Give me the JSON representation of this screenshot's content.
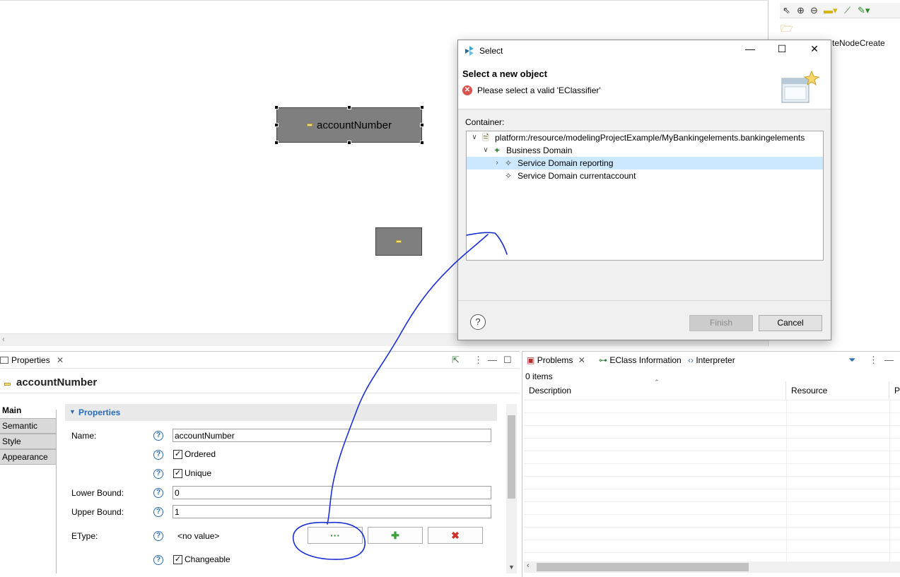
{
  "canvas": {
    "node_main_label": "accountNumber"
  },
  "palette": {
    "partial_label": "teNodeCreate",
    "tools": [
      "select-icon",
      "zoom-in-icon",
      "zoom-out-icon",
      "note-icon",
      "connection-icon",
      "pin-icon"
    ]
  },
  "dialog": {
    "title": "Select",
    "heading": "Select a new object",
    "error_message": "Please select a valid 'EClassifier'",
    "container_label": "Container:",
    "tree": [
      {
        "label": "platform:/resource/modelingProjectExample/MyBankingelements.bankingelements",
        "expanded": true,
        "level": 0
      },
      {
        "label": "Business Domain",
        "expanded": true,
        "level": 1
      },
      {
        "label": "Service Domain reporting",
        "expanded": false,
        "level": 2,
        "selected": true
      },
      {
        "label": "Service Domain currentaccount",
        "expanded": false,
        "level": 2
      }
    ],
    "help_symbol": "?",
    "finish_label": "Finish",
    "cancel_label": "Cancel",
    "minimize_symbol": "—",
    "maximize_symbol": "☐",
    "close_symbol": "✕"
  },
  "properties": {
    "tab_label": "Properties",
    "title": "accountNumber",
    "side_tabs": [
      "Main",
      "Semantic",
      "Style",
      "Appearance"
    ],
    "active_side_tab": "Main",
    "section_title": "Properties",
    "name_label": "Name:",
    "name_value": "accountNumber",
    "ordered_label": "Ordered",
    "ordered_checked": true,
    "unique_label": "Unique",
    "unique_checked": true,
    "lower_bound_label": "Lower Bound:",
    "lower_bound_value": "0",
    "upper_bound_label": "Upper Bound:",
    "upper_bound_value": "1",
    "etype_label": "EType:",
    "etype_value": "<no value>",
    "browse_button": "···",
    "add_button": "✚",
    "remove_button": "✖",
    "changeable_label": "Changeable",
    "changeable_checked": true,
    "help_symbol": "?"
  },
  "problems": {
    "tabs": [
      "Problems",
      "EClass Information",
      "Interpreter"
    ],
    "count": "0 items",
    "columns": [
      "Description",
      "Resource",
      "Pa"
    ]
  },
  "colors": {
    "accent": "#2a6cb5",
    "selection": "#cce8ff",
    "annotation": "#1a2fd6",
    "error": "#d9534f",
    "node_fill": "#7f7f7f"
  }
}
